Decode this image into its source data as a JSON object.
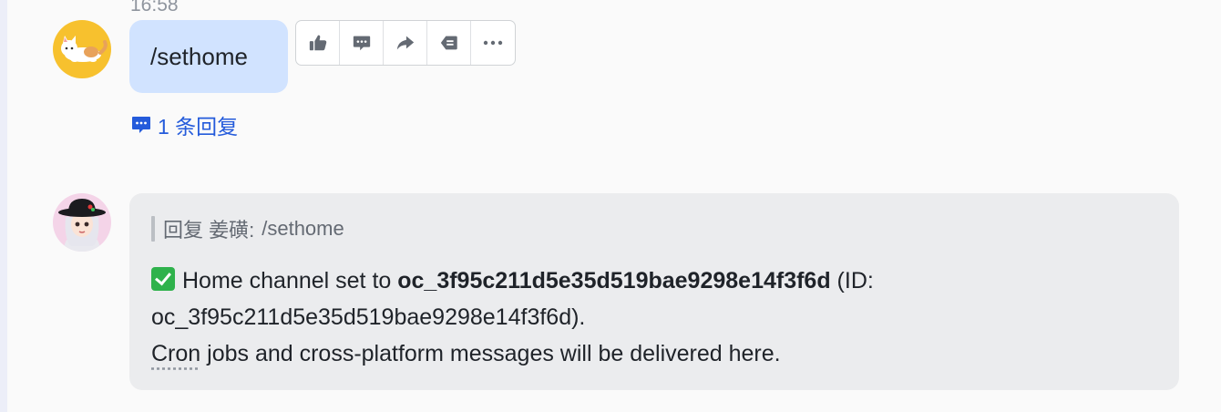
{
  "thread": {
    "timestamp": "16:58"
  },
  "user_message": {
    "text": "/sethome",
    "bubble_color": "#d1e3ff"
  },
  "toolbar": {
    "icons": [
      "thumbs-up-icon",
      "comment-icon",
      "forward-icon",
      "quote-reply-icon",
      "more-icon"
    ]
  },
  "replies": {
    "label": "1 条回复",
    "accent": "#245bdb"
  },
  "bot_reply": {
    "quote_prefix": "回复 姜磺:",
    "quote_text": "/sethome",
    "line1_prefix": "Home channel set to ",
    "channel_id": "oc_3f95c211d5e35d519bae9298e14f3f6d",
    "line1_suffix": " (ID:",
    "line2": "oc_3f95c211d5e35d519bae9298e14f3f6d).",
    "line3_word": "Cron",
    "line3_rest": " jobs and cross-platform messages will be delivered here.",
    "card_color": "#ebecee"
  }
}
